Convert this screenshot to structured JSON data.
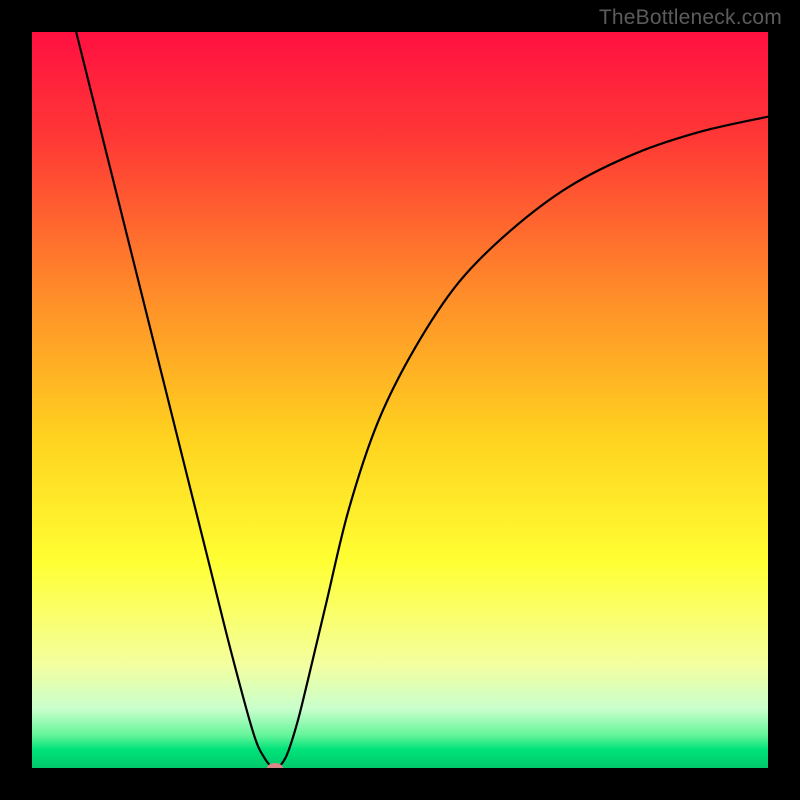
{
  "watermark": "TheBottleneck.com",
  "chart_data": {
    "type": "line",
    "title": "",
    "xlabel": "",
    "ylabel": "",
    "xlim": [
      0,
      1
    ],
    "ylim": [
      0,
      1
    ],
    "grid": false,
    "legend": false,
    "gradient_stops": [
      {
        "pos": 0.0,
        "color": "#ff1041"
      },
      {
        "pos": 0.15,
        "color": "#ff3a35"
      },
      {
        "pos": 0.35,
        "color": "#ff8a2a"
      },
      {
        "pos": 0.55,
        "color": "#ffd21f"
      },
      {
        "pos": 0.72,
        "color": "#ffff33"
      },
      {
        "pos": 0.86,
        "color": "#f4ffa0"
      },
      {
        "pos": 0.92,
        "color": "#c8ffcd"
      },
      {
        "pos": 0.955,
        "color": "#66f59a"
      },
      {
        "pos": 0.975,
        "color": "#00e37a"
      },
      {
        "pos": 1.0,
        "color": "#00c86b"
      }
    ],
    "series": [
      {
        "name": "bottleneck-curve",
        "color": "#000000",
        "x": [
          0.06,
          0.09,
          0.12,
          0.15,
          0.18,
          0.21,
          0.24,
          0.27,
          0.3,
          0.315,
          0.33,
          0.345,
          0.36,
          0.375,
          0.4,
          0.43,
          0.47,
          0.52,
          0.58,
          0.65,
          0.73,
          0.82,
          0.91,
          1.0
        ],
        "y": [
          1.0,
          0.88,
          0.76,
          0.64,
          0.52,
          0.4,
          0.28,
          0.16,
          0.05,
          0.015,
          0.0,
          0.015,
          0.06,
          0.12,
          0.225,
          0.35,
          0.47,
          0.57,
          0.66,
          0.73,
          0.79,
          0.835,
          0.865,
          0.885
        ]
      }
    ],
    "marker": {
      "x": 0.33,
      "y": 0.0,
      "color": "#d98787"
    }
  }
}
